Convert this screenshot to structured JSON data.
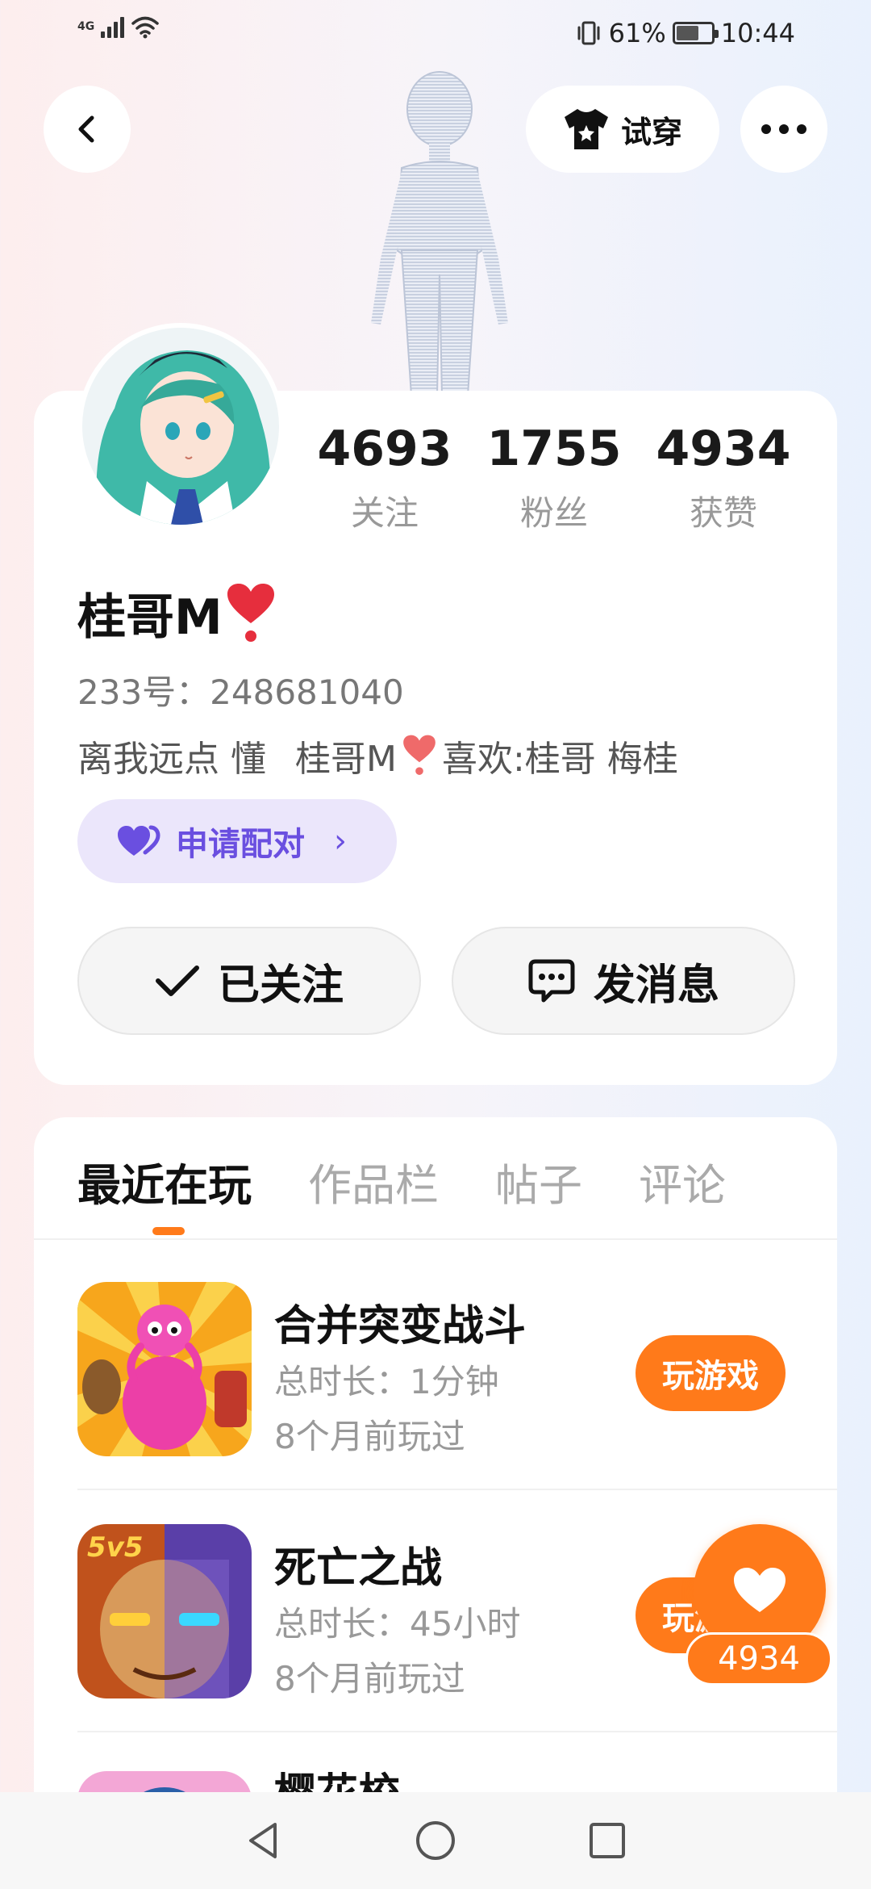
{
  "status_bar": {
    "network_type": "4G",
    "battery_percent": "61%",
    "time": "10:44",
    "icons": [
      "signal-icon",
      "wifi-icon",
      "vibrate-icon",
      "battery-icon"
    ]
  },
  "header": {
    "try_on_label": "试穿",
    "icons": [
      "back-icon",
      "shirt-icon",
      "more-icon"
    ]
  },
  "profile": {
    "stats": [
      {
        "value": "4693",
        "label": "关注"
      },
      {
        "value": "1755",
        "label": "粉丝"
      },
      {
        "value": "4934",
        "label": "获赞"
      }
    ],
    "username": "桂哥M",
    "uid": "233号：248681040",
    "bio_part1": "离我远点 懂",
    "bio_part2": "桂哥M",
    "bio_part3": "喜欢:桂哥 梅桂",
    "pair_label": "申请配对",
    "follow_label": "已关注",
    "message_label": "发消息"
  },
  "tabs": [
    {
      "label": "最近在玩",
      "active": true
    },
    {
      "label": "作品栏",
      "active": false
    },
    {
      "label": "帖子",
      "active": false
    },
    {
      "label": "评论",
      "active": false
    }
  ],
  "games": [
    {
      "name": "合并突变战斗",
      "duration": "总时长：1分钟",
      "last_played": "8个月前玩过",
      "button": "玩游戏"
    },
    {
      "name": "死亡之战",
      "duration": "总时长：45小时",
      "last_played": "8个月前玩过",
      "button": "玩游戏"
    },
    {
      "name": "樱花校",
      "duration": "",
      "last_played": "",
      "button": ""
    }
  ],
  "floating_like": {
    "count": "4934"
  },
  "colors": {
    "accent": "#ff7a1a",
    "pair_bg": "#ebe6fb",
    "pair_text": "#6a4fe0"
  }
}
